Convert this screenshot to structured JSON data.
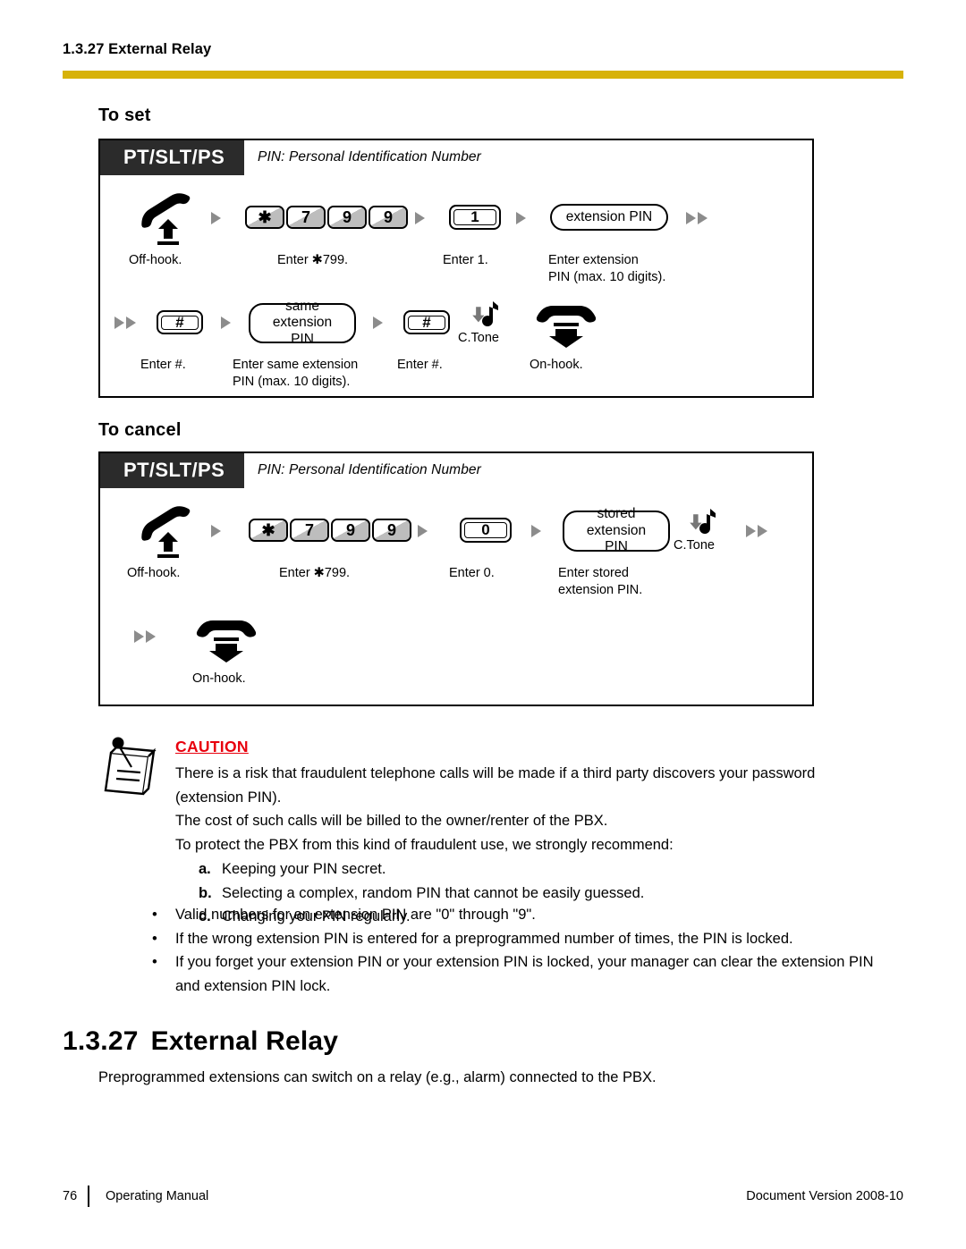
{
  "running_header": "1.3.27 External Relay",
  "accent_color": "#d7b209",
  "caution_color": "#e8000d",
  "sections": {
    "to_set": {
      "heading": "To set",
      "panel_banner": "PT/SLT/PS",
      "panel_note": "PIN: Personal Identification Number",
      "steps": [
        {
          "icon": "offhook-handset-icon",
          "caption": "Off-hook."
        },
        {
          "keys": [
            "✱",
            "7",
            "9",
            "9"
          ],
          "caption": "Enter ✱799."
        },
        {
          "key": "1",
          "caption": "Enter 1."
        },
        {
          "capsule": "extension PIN",
          "caption": "Enter extension\nPIN (max. 10 digits)."
        },
        {
          "key": "#",
          "caption": "Enter #."
        },
        {
          "capsule": "same\nextension PIN",
          "caption": "Enter same extension\nPIN (max. 10 digits)."
        },
        {
          "key": "#",
          "caption": "Enter #."
        },
        {
          "icon": "tone-note-icon",
          "label": "C.Tone"
        },
        {
          "icon": "onhook-handset-icon",
          "caption": "On-hook."
        }
      ]
    },
    "to_cancel": {
      "heading": "To cancel",
      "panel_banner": "PT/SLT/PS",
      "panel_note": "PIN: Personal Identification Number",
      "steps": [
        {
          "icon": "offhook-handset-icon",
          "caption": "Off-hook."
        },
        {
          "keys": [
            "✱",
            "7",
            "9",
            "9"
          ],
          "caption": "Enter ✱799."
        },
        {
          "key": "0",
          "caption": "Enter 0."
        },
        {
          "capsule": "stored\nextension PIN",
          "caption": "Enter stored\nextension PIN."
        },
        {
          "icon": "tone-note-icon",
          "label": "C.Tone"
        },
        {
          "icon": "onhook-handset-icon",
          "caption": "On-hook."
        }
      ]
    }
  },
  "caution": {
    "title": "CAUTION",
    "paragraphs": [
      "There is a risk that fraudulent telephone calls will be made if a third party discovers your password (extension PIN).",
      "The cost of such calls will be billed to the owner/renter of the PBX.",
      "To protect the PBX from this kind of fraudulent use, we strongly recommend:"
    ],
    "lettered": [
      {
        "mark": "a.",
        "text": "Keeping your PIN secret."
      },
      {
        "mark": "b.",
        "text": "Selecting a complex, random PIN that cannot be easily guessed."
      },
      {
        "mark": "c.",
        "text": "Changing your PIN regularly."
      }
    ],
    "bullets": [
      "Valid numbers for an extension PIN are \"0\" through \"9\".",
      "If the wrong extension PIN is entered for a preprogrammed number of times, the PIN is locked.",
      "If you forget your extension PIN or your extension PIN is locked, your manager can clear the extension PIN and extension PIN lock."
    ],
    "bullet_glyph": "•"
  },
  "section_1327": {
    "number": "1.3.27",
    "title": "External Relay",
    "body": "Preprogrammed extensions can switch on a relay (e.g., alarm) connected to the PBX."
  },
  "footer": {
    "page_number": "76",
    "manual_title": "Operating Manual",
    "document_version": "Document Version  2008-10"
  }
}
